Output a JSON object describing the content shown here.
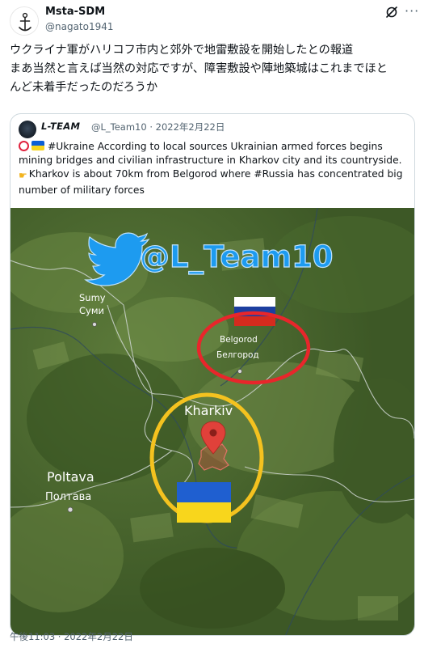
{
  "author": {
    "display_name": "Msta-SDM",
    "handle": "@nagato1941"
  },
  "tweet": {
    "lines": [
      "ウクライナ軍がハリコフ市内と郊外で地雷敷設を開始したとの報道",
      "まあ当然と言えば当然の対応ですが、障害敷設や陣地築城はこれまでほと",
      "んど未着手だったのだろうか"
    ],
    "timestamp": "午後11:03 · 2022年2月22日"
  },
  "quoted": {
    "name": "L-TEAM",
    "handle_date": "@L_Team10 · 2022年2月22日",
    "line1": "#Ukraine According to local sources Ukrainian armed forces  begins",
    "line2": "mining bridges and civilian infrastructure in Kharkov city and its countryside.",
    "line3": "Kharkov is about 70km from Belgorod where #Russia has concentrated big",
    "line4": "number of military forces"
  },
  "map": {
    "watermark": "@L_Team10",
    "cities": {
      "sumy_latin": "Sumy",
      "sumy_cyr": "Суми",
      "belgorod_latin": "Belgorod",
      "belgorod_cyr": "Белгород",
      "kharkiv": "Kharkiv",
      "poltava_latin": "Poltava",
      "poltava_cyr": "Полтава"
    },
    "colors": {
      "red_circle": "#e8262b",
      "yellow_circle": "#f4c21f",
      "twitter_blue": "#1d9bf0",
      "ukraine_blue": "#1f5fd0",
      "ukraine_yellow": "#f8d61c",
      "russia_red": "#d52b1e",
      "russia_blue": "#1c3fa0"
    }
  },
  "icons": {
    "grok": "grok-icon",
    "more": "more-options-icon",
    "circle": "red-circle-emoji",
    "flag": "ukraine-flag-emoji",
    "hand": "pointing-hand-emoji"
  }
}
